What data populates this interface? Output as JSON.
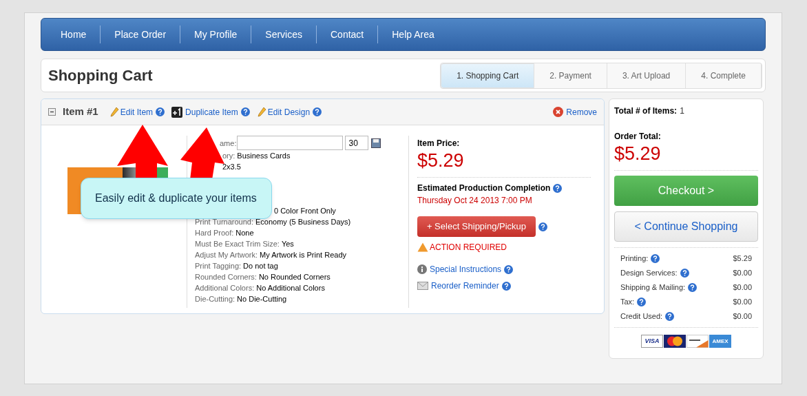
{
  "nav": [
    {
      "label": "Home"
    },
    {
      "label": "Place Order"
    },
    {
      "label": "My Profile"
    },
    {
      "label": "Services"
    },
    {
      "label": "Contact"
    },
    {
      "label": "Help Area"
    }
  ],
  "page_title": "Shopping Cart",
  "steps": [
    {
      "label": "1. Shopping Cart",
      "selected": true
    },
    {
      "label": "2. Payment",
      "selected": false
    },
    {
      "label": "3. Art Upload",
      "selected": false
    },
    {
      "label": "4. Complete",
      "selected": false
    }
  ],
  "item": {
    "title": "Item #1",
    "expanded": true,
    "actions": [
      {
        "kind": "edit",
        "label": "Edit Item"
      },
      {
        "kind": "duplicate",
        "label": "Duplicate Item"
      },
      {
        "kind": "edit",
        "label": "Edit Design"
      }
    ],
    "remove": "Remove",
    "name_label": "ame:",
    "quantity_value": "30",
    "details_top": [
      {
        "label": "ory:",
        "value": "Business Cards"
      },
      {
        "value": "2x3.5"
      }
    ],
    "colors_fragment": "0 Color Front Only",
    "details": [
      {
        "label": "Print Turnaround:",
        "value": "Economy (5 Business Days)"
      },
      {
        "label": "Hard Proof:",
        "value": "None"
      },
      {
        "label": "Must Be Exact Trim Size:",
        "value": "Yes"
      },
      {
        "label": "Adjust My Artwork:",
        "value": "My Artwork is Print Ready"
      },
      {
        "label": "Print Tagging:",
        "value": "Do not tag"
      },
      {
        "label": "Rounded Corners:",
        "value": "No Rounded Corners"
      },
      {
        "label": "Additional Colors:",
        "value": "No Additional Colors"
      },
      {
        "label": "Die-Cutting:",
        "value": "No Die-Cutting"
      }
    ],
    "price_label": "Item Price:",
    "price": "$5.29",
    "completion_label": "Estimated Production Completion",
    "completion_date": "Thursday Oct 24 2013 7:00 PM",
    "shipping_button": "+ Select Shipping/Pickup",
    "action_required": "ACTION REQUIRED",
    "links": [
      {
        "kind": "info",
        "label": "Special Instructions"
      },
      {
        "kind": "mail",
        "label": "Reorder Reminder"
      }
    ]
  },
  "callout": "Easily edit & duplicate your items",
  "summary": {
    "items_label": "Total # of Items:",
    "items_count": "1",
    "total_label": "Order Total:",
    "total": "$5.29",
    "checkout": "Checkout >",
    "continue": "< Continue Shopping",
    "lines": [
      {
        "label": "Printing:",
        "amount": "$5.29"
      },
      {
        "label": "Design Services:",
        "amount": "$0.00"
      },
      {
        "label": "Shipping & Mailing:",
        "amount": "$0.00"
      },
      {
        "label": "Tax:",
        "amount": "$0.00"
      },
      {
        "label": "Credit Used:",
        "amount": "$0.00"
      }
    ],
    "cards": [
      {
        "kind": "visa",
        "label": "VISA"
      },
      {
        "kind": "mastercard"
      },
      {
        "kind": "discover"
      },
      {
        "kind": "amex",
        "label": "AMEX"
      }
    ]
  }
}
